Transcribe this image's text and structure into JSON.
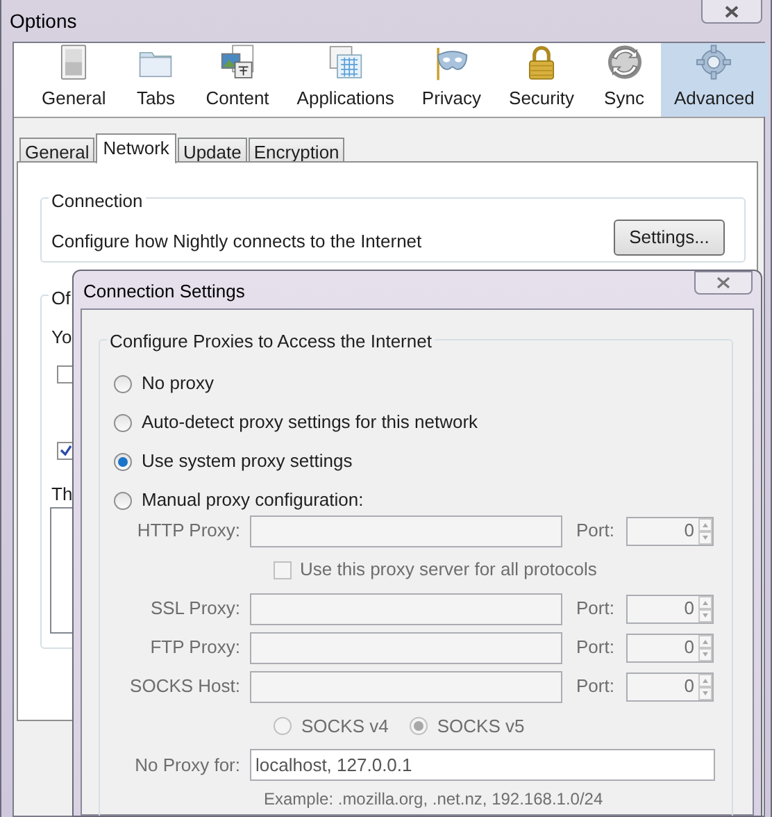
{
  "window": {
    "title": "Options"
  },
  "toolbar": [
    {
      "label": "General",
      "selected": false
    },
    {
      "label": "Tabs",
      "selected": false
    },
    {
      "label": "Content",
      "selected": false
    },
    {
      "label": "Applications",
      "selected": false
    },
    {
      "label": "Privacy",
      "selected": false
    },
    {
      "label": "Security",
      "selected": false
    },
    {
      "label": "Sync",
      "selected": false
    },
    {
      "label": "Advanced",
      "selected": true
    }
  ],
  "tabs": [
    {
      "label": "General",
      "selected": false
    },
    {
      "label": "Network",
      "selected": true
    },
    {
      "label": "Update",
      "selected": false
    },
    {
      "label": "Encryption",
      "selected": false
    }
  ],
  "connection": {
    "title": "Connection",
    "description": "Configure how Nightly connects to the Internet",
    "button": "Settings..."
  },
  "offline": {
    "title": "Of",
    "line": "Yo",
    "checkboxes": [
      {
        "checked": false
      },
      {
        "checked": true
      }
    ],
    "line_2": "Th"
  },
  "dialog": {
    "title": "Connection Settings",
    "group_title": "Configure Proxies to Access the Internet",
    "options": [
      {
        "label": "No proxy",
        "selected": false
      },
      {
        "label": "Auto-detect proxy settings for this network",
        "selected": false
      },
      {
        "label": "Use system proxy settings",
        "selected": true
      },
      {
        "label": "Manual proxy configuration:",
        "selected": false
      }
    ],
    "proxies": [
      {
        "label": "HTTP Proxy:",
        "port_label": "Port:",
        "port": "0",
        "disabled": true
      },
      {
        "label": "SSL Proxy:",
        "port_label": "Port:",
        "port": "0",
        "disabled": true
      },
      {
        "label": "FTP Proxy:",
        "port_label": "Port:",
        "port": "0",
        "disabled": true
      },
      {
        "label": "SOCKS Host:",
        "port_label": "Port:",
        "port": "0",
        "disabled": true
      }
    ],
    "share": {
      "label": "Use this proxy server for all protocols",
      "checked": false,
      "disabled": true
    },
    "socks_versions": [
      {
        "label": "SOCKS v4",
        "selected": false,
        "disabled": true
      },
      {
        "label": "SOCKS v5",
        "selected": true,
        "disabled": true
      }
    ],
    "no_proxy": {
      "label": "No Proxy for:",
      "value": "localhost, 127.0.0.1"
    },
    "example": "Example: .mozilla.org, .net.nz, 192.168.1.0/24"
  }
}
